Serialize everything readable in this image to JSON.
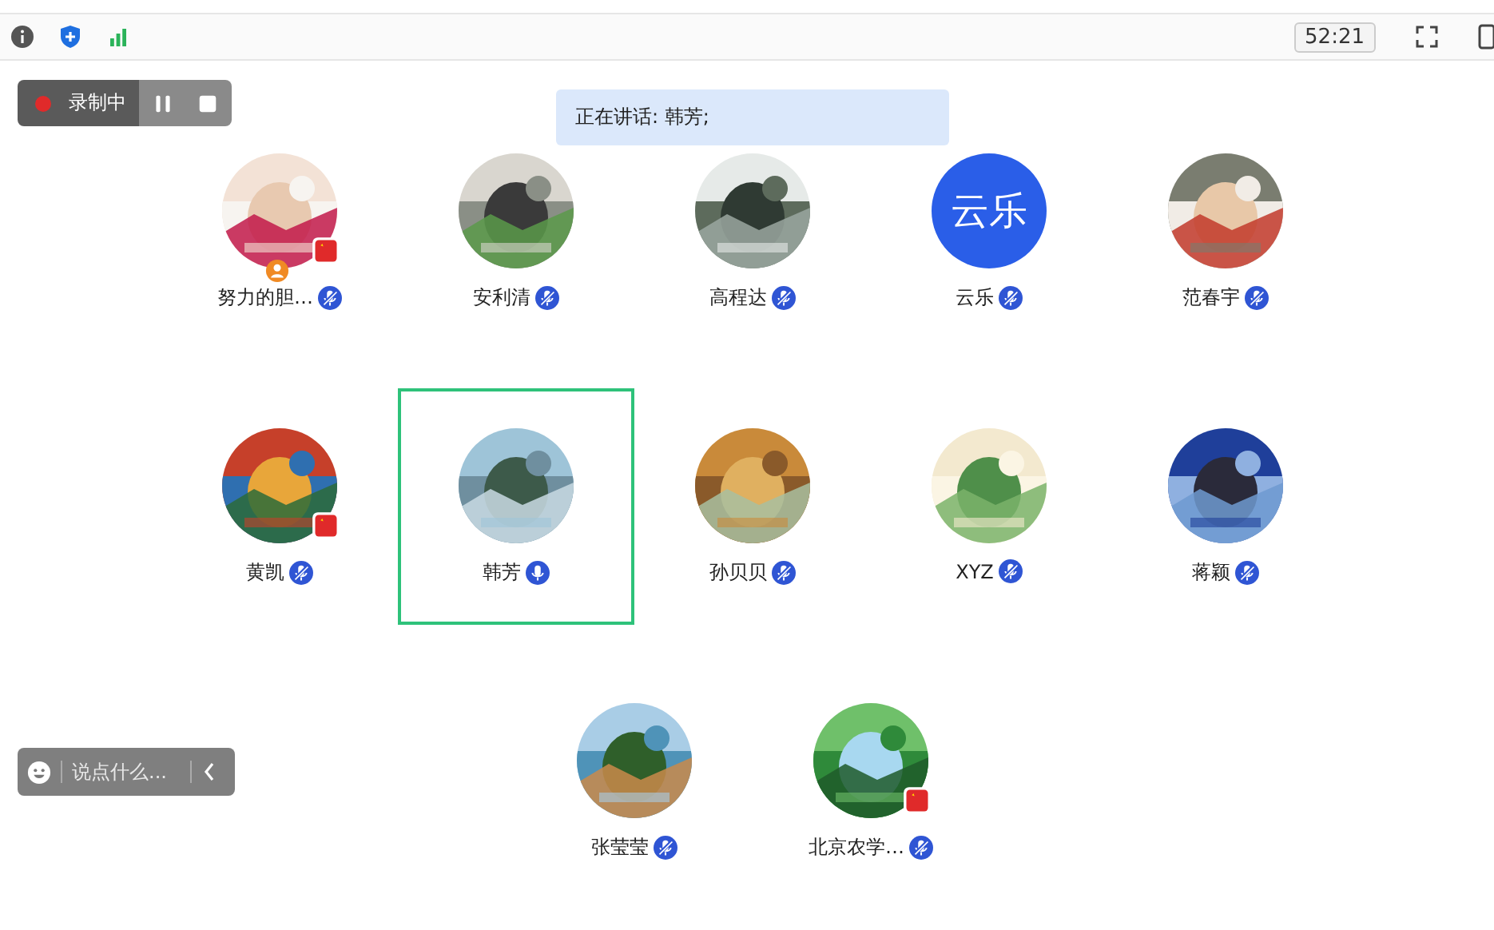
{
  "toolbar": {
    "timer": "52:21"
  },
  "recording": {
    "label": "录制中"
  },
  "speaking": {
    "text": "正在讲话: 韩芳;"
  },
  "participants": [
    {
      "name": "努力的胆…",
      "flag": true,
      "host": true,
      "muted": true,
      "selected": false
    },
    {
      "name": "安利清",
      "flag": false,
      "host": false,
      "muted": true,
      "selected": false
    },
    {
      "name": "高程达",
      "flag": false,
      "host": false,
      "muted": true,
      "selected": false
    },
    {
      "name": "云乐",
      "avatar": {
        "kind": "text",
        "text": "云乐"
      },
      "flag": false,
      "host": false,
      "muted": true,
      "selected": false
    },
    {
      "name": "范春宇",
      "flag": false,
      "host": false,
      "muted": true,
      "selected": false
    },
    {
      "name": "黄凯",
      "flag": true,
      "host": false,
      "muted": true,
      "selected": false
    },
    {
      "name": "韩芳",
      "flag": false,
      "host": false,
      "muted": false,
      "selected": true
    },
    {
      "name": "孙贝贝",
      "flag": false,
      "host": false,
      "muted": true,
      "selected": false
    },
    {
      "name": "XYZ",
      "flag": false,
      "host": false,
      "muted": true,
      "selected": false
    },
    {
      "name": "蒋颖",
      "flag": false,
      "host": false,
      "muted": true,
      "selected": false
    },
    {
      "name": "张莹莹",
      "flag": false,
      "host": false,
      "muted": true,
      "selected": false
    },
    {
      "name": "北京农学…",
      "flag": true,
      "host": false,
      "muted": true,
      "selected": false
    }
  ],
  "chat": {
    "placeholder": "说点什么..."
  }
}
